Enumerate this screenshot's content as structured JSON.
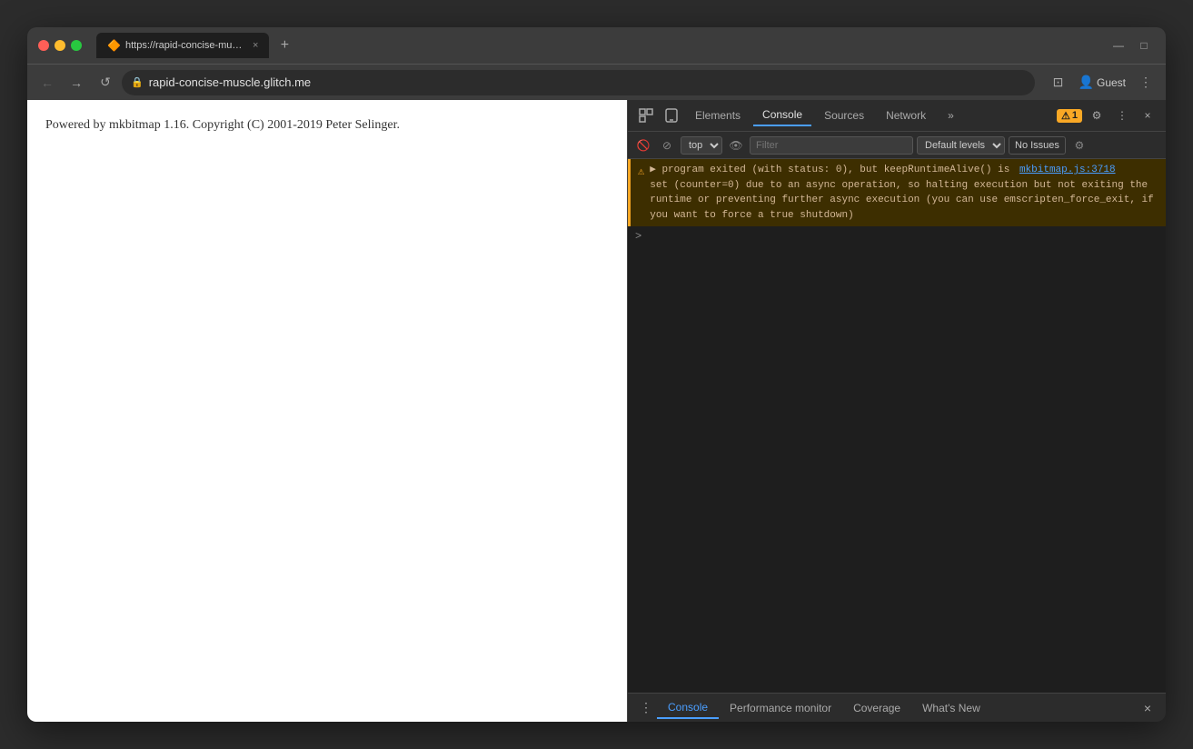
{
  "browser": {
    "tab": {
      "favicon": "🔶",
      "title": "https://rapid-concise-muscle.g…",
      "close": "×"
    },
    "tab_new": "+",
    "title_bar_actions": [
      "⊞",
      "□"
    ],
    "address": "rapid-concise-muscle.glitch.me",
    "nav": {
      "back": "←",
      "forward": "→",
      "refresh": "↺",
      "lock": "🔒"
    },
    "nav_right": {
      "profile_icon": "👤",
      "profile_name": "Guest",
      "menu": "⋮",
      "extensions": "⊡",
      "profile_btn": "👤"
    }
  },
  "webpage": {
    "content": "Powered by mkbitmap 1.16. Copyright (C) 2001-2019 Peter Selinger."
  },
  "devtools": {
    "tabs": [
      "Elements",
      "Console",
      "Sources",
      "Network"
    ],
    "active_tab": "Console",
    "more_tabs": "»",
    "warning_count": "1",
    "toolbar_icons": {
      "inspect": "⊡",
      "device": "📱",
      "settings": "⚙",
      "more": "⋮",
      "close": "×"
    },
    "console_toolbar": {
      "clear": "🚫",
      "block": "⊘",
      "context": "top",
      "eye": "👁",
      "filter_placeholder": "Filter",
      "levels": "Default levels",
      "no_issues": "No Issues",
      "settings": "⚙"
    },
    "warning_message": {
      "prefix": "▶ program exited (with status: 0), but keepRuntimeAlive() is",
      "link_text": "mkbitmap.js:3718",
      "link_url": "#",
      "continuation": "set (counter=0) due to an async operation, so halting execution but not exiting the runtime or preventing further async execution (you can use emscripten_force_exit, if you want to force a true shutdown)"
    },
    "prompt": ">",
    "bottom_tabs": [
      "Console",
      "Performance monitor",
      "Coverage",
      "What's New"
    ],
    "active_bottom_tab": "Console",
    "bottom_close": "×"
  }
}
